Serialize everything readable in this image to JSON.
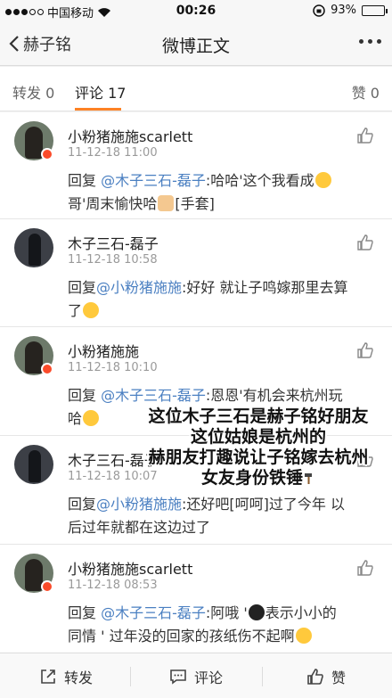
{
  "status_bar": {
    "carrier": "中国移动",
    "time": "00:26",
    "battery": "93%",
    "battery_level": 0.93
  },
  "nav": {
    "back_label": "赫子铭",
    "title": "微博正文"
  },
  "tabs": {
    "repost": "转发 0",
    "comment": "评论 17",
    "like": "赞 0"
  },
  "comments": [
    {
      "name": "小粉猪施施scarlett",
      "time": "11-12-18 11:00",
      "prefix": "回复 ",
      "mention": "@木子三石-磊子",
      "line1": ":哈哈'这个我看成",
      "line2": "哥'周末愉快哈",
      "tag": "[手套]"
    },
    {
      "name": "木子三石-磊子",
      "time": "11-12-18 10:58",
      "prefix": "回复",
      "mention": "@小粉猪施施",
      "line1": ":好好 就让子鸣嫁那里去算",
      "line2": "了"
    },
    {
      "name": "小粉猪施施",
      "time": "11-12-18 10:10",
      "prefix": "回复 ",
      "mention": "@木子三石-磊子",
      "line1": ":恩恩'有机会来杭州玩",
      "line2": "哈"
    },
    {
      "name": "木子三石-磊子",
      "time": "11-12-18 10:07",
      "prefix": "回复",
      "mention": "@小粉猪施施",
      "line1": ":还好吧[呵呵]过了今年 以",
      "line2": "后过年就都在这边过了"
    },
    {
      "name": "小粉猪施施scarlett",
      "time": "11-12-18 08:53",
      "prefix": "回复 ",
      "mention": "@木子三石-磊子",
      "line1": ":阿哦 '",
      "line1b": "表示小小的",
      "line2": "同情 ' 过年没的回家的孩纸伤不起啊"
    }
  ],
  "overlay": {
    "line1": "这位木子三石是赫子铭好朋友",
    "line2": "这位姑娘是杭州的",
    "line3": "赫朋友打趣说让子铭嫁去杭州",
    "line4": "女友身份铁锤"
  },
  "bottom_bar": {
    "repost": "转发",
    "comment": "评论",
    "like": "赞"
  },
  "colors": {
    "mention": "#4a7fc1",
    "accent": "#fd8225",
    "badge": "#fb4b2a"
  }
}
